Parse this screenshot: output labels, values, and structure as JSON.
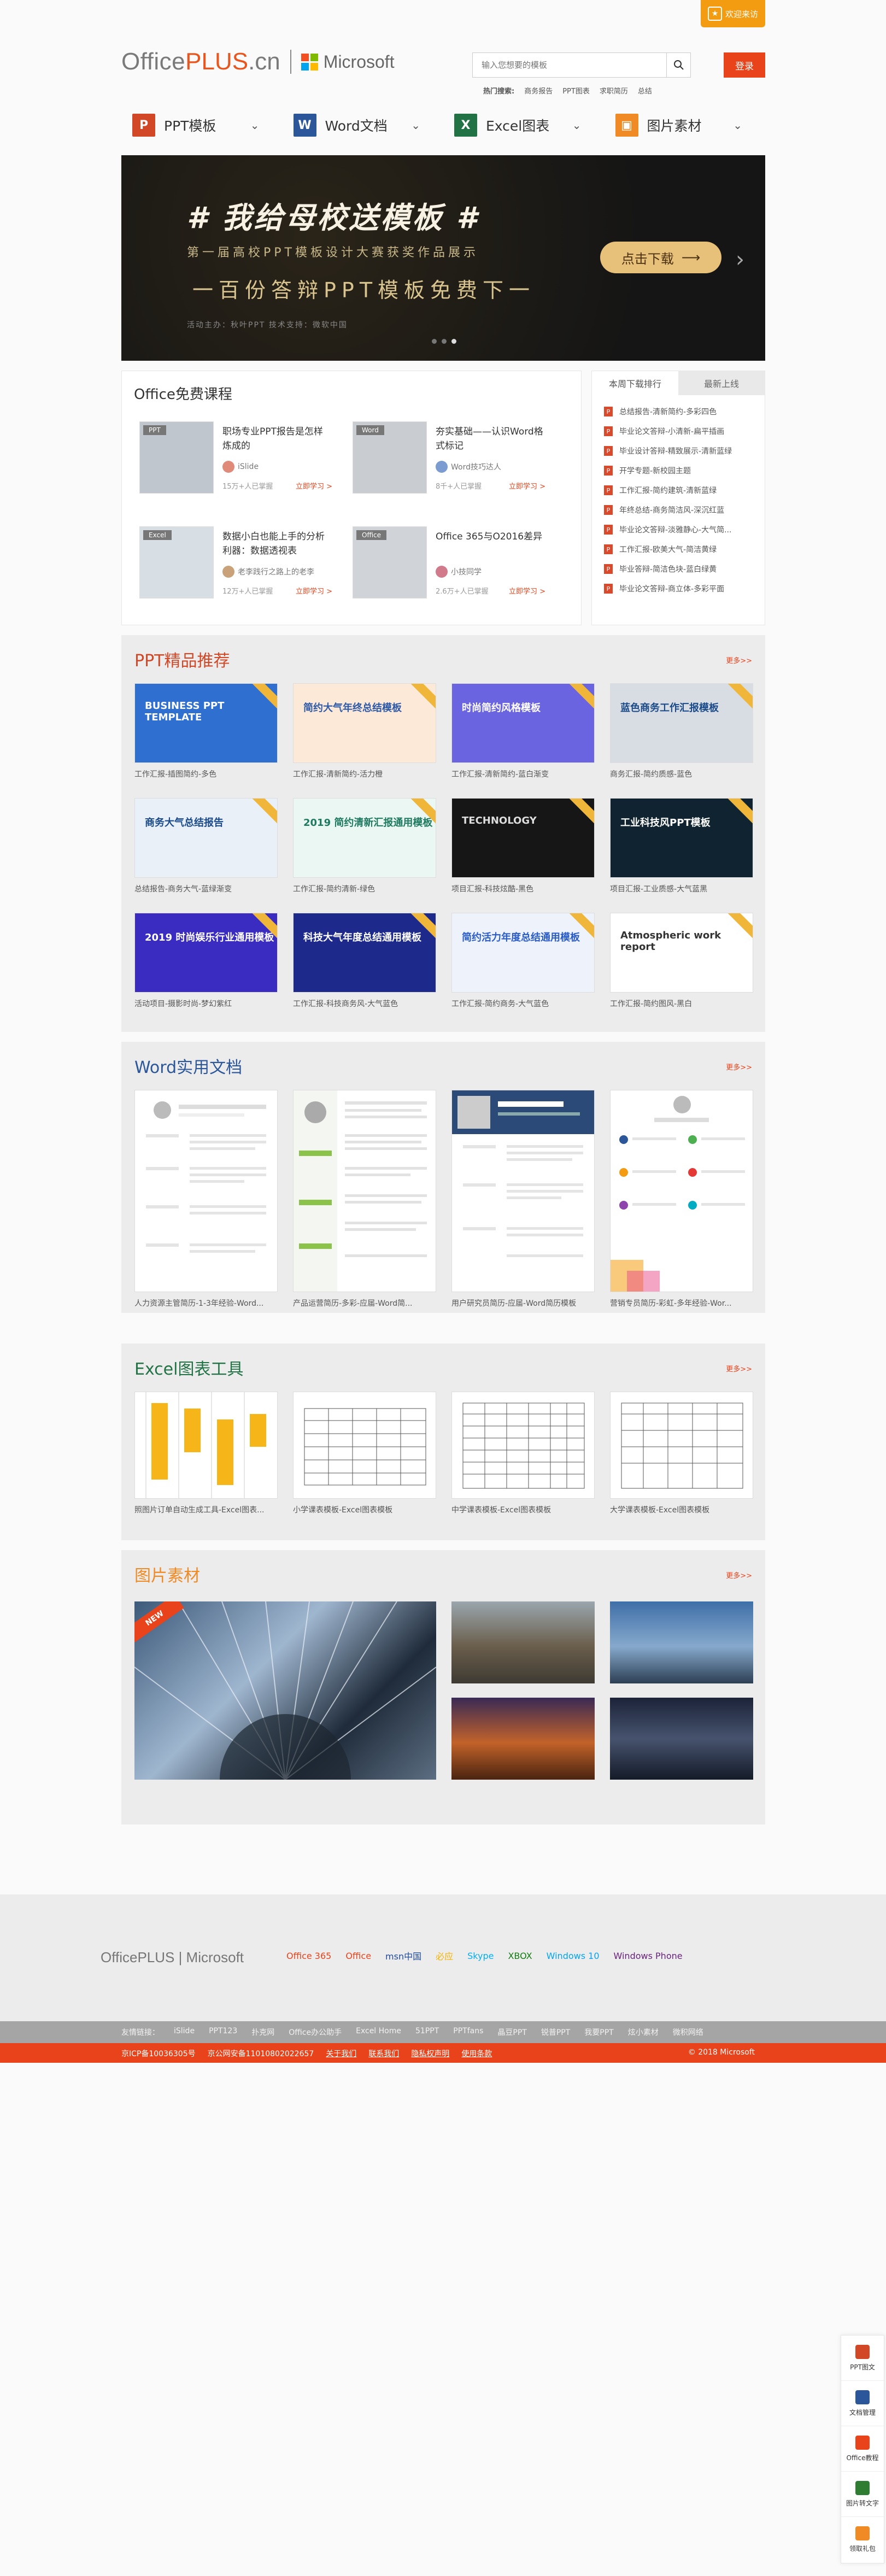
{
  "header": {
    "fav_label": "欢迎来访",
    "logo": {
      "office": "Office",
      "plus": "PLUS",
      "cn": ".cn",
      "ms": "Microsoft"
    },
    "search_placeholder": "输入您想要的模板",
    "login_label": "登录",
    "hot_label": "热门搜索:",
    "hot_items": [
      "商务报告",
      "PPT图表",
      "求职简历",
      "总结"
    ]
  },
  "nav": [
    {
      "label": "PPT模板",
      "icon": "P",
      "color": "#d24726"
    },
    {
      "label": "Word文档",
      "icon": "W",
      "color": "#2b579a"
    },
    {
      "label": "Excel图表",
      "icon": "X",
      "color": "#217346"
    },
    {
      "label": "图片素材",
      "icon": "▣",
      "color": "#f08a24"
    }
  ],
  "banner": {
    "title": "# 我给母校送模板 #",
    "subtitle": "第一届高校PPT模板设计大赛获奖作品展示",
    "subtitle2": "一百份答辩PPT模板免费下一",
    "footer": "活动主办：秋叶PPT     技术支持：微软中国",
    "button": "点击下载"
  },
  "courses": {
    "title": "Office免费课程",
    "items": [
      {
        "tag": "PPT",
        "title": "职场专业PPT报告是怎样炼成的",
        "author": "iSlide",
        "learners": "15万+人已掌握",
        "go": "立即学习 >"
      },
      {
        "tag": "Word",
        "title": "夯实基础——认识Word格式标记",
        "author": "Word技巧达人",
        "learners": "8千+人已掌握",
        "go": "立即学习 >"
      },
      {
        "tag": "Excel",
        "title": "数据小白也能上手的分析利器：数据透视表",
        "author": "老李践行之路上的老李",
        "learners": "12万+人已掌握",
        "go": "立即学习 >"
      },
      {
        "tag": "Office",
        "title": "Office 365与O2016差异",
        "author": "小技同学",
        "learners": "2.6万+人已掌握",
        "go": "立即学习 >"
      }
    ]
  },
  "ranking": {
    "tab1": "本周下载排行",
    "tab2": "最新上线",
    "items": [
      "总结报告-清新简约-多彩四色",
      "毕业论文答辩-小清新-扁平插画",
      "毕业设计答辩-精致展示-清新蓝绿",
      "开学专题-新校园主题",
      "工作汇报-简约建筑-清新蓝绿",
      "年终总结-商务简洁风-深沉红蓝",
      "毕业论文答辩-淡雅静心-大气简...",
      "工作汇报-欧美大气-简洁黄绿",
      "毕业答辩-简洁色块-蓝白绿黄",
      "毕业论文答辩-商立体-多彩平面"
    ]
  },
  "ppt": {
    "title": "PPT精品推荐",
    "more": "更多>>",
    "items": [
      {
        "cap": "工作汇报-插图简约-多色",
        "bg": "#2f6fd0",
        "text": "BUSINESS PPT TEMPLATE",
        "fg": "#ffffff"
      },
      {
        "cap": "工作汇报-清新简约-活力橙",
        "bg": "#fde9d8",
        "text": "简约大气年终总结模板",
        "fg": "#2d5aa8"
      },
      {
        "cap": "工作汇报-清新简约-蓝白渐变",
        "bg": "#6b64e0",
        "text": "时尚简约风格模板",
        "fg": "#ffffff"
      },
      {
        "cap": "商务汇报-简约质感-蓝色",
        "bg": "#d7dde2",
        "text": "蓝色商务工作汇报模板",
        "fg": "#1b4a8a"
      },
      {
        "cap": "总结报告-商务大气-蓝绿渐变",
        "bg": "#e9f0f7",
        "text": "商务大气总结报告",
        "fg": "#1b4a8a"
      },
      {
        "cap": "工作汇报-简约清新-绿色",
        "bg": "#eaf7f2",
        "text": "2019 简约清新汇报通用模板",
        "fg": "#1f7a60"
      },
      {
        "cap": "项目汇报-科技炫酷-黑色",
        "bg": "#161616",
        "text": "TECHNOLOGY",
        "fg": "#dddddd"
      },
      {
        "cap": "项目汇报-工业质感-大气蓝黑",
        "bg": "#0f2430",
        "text": "工业科技风PPT模板",
        "fg": "#ffffff"
      },
      {
        "cap": "活动项目-摄影时尚-梦幻紫红",
        "bg": "#3a2cc0",
        "text": "2019 时尚娱乐行业通用模板",
        "fg": "#ffffff"
      },
      {
        "cap": "工作汇报-科技商务风-大气蓝色",
        "bg": "#1d2a8c",
        "text": "科技大气年度总结通用模板",
        "fg": "#ffffff"
      },
      {
        "cap": "工作汇报-简约商务-大气蓝色",
        "bg": "#eef3fb",
        "text": "简约活力年度总结通用模板",
        "fg": "#2a5cc8"
      },
      {
        "cap": "工作汇报-简约图风-黑白",
        "bg": "#ffffff",
        "text": "Atmospheric work report",
        "fg": "#333333"
      }
    ]
  },
  "word": {
    "title": "Word实用文档",
    "more": "更多>>",
    "items": [
      {
        "cap": "人力资源主管简历-1-3年经验-Word..."
      },
      {
        "cap": "产品运营简历-多彩-应届-Word简..."
      },
      {
        "cap": "用户研究员简历-应届-Word简历模板"
      },
      {
        "cap": "营销专员简历-彩虹-多年经验-Wor..."
      }
    ]
  },
  "excel": {
    "title": "Excel图表工具",
    "more": "更多>>",
    "items": [
      {
        "cap": "照图片订单自动生成工具-Excel图表..."
      },
      {
        "cap": "小学课表模板-Excel图表模板"
      },
      {
        "cap": "中学课表模板-Excel图表模板"
      },
      {
        "cap": "大学课表模板-Excel图表模板"
      }
    ]
  },
  "images": {
    "title": "图片素材",
    "more": "更多>>",
    "new_badge": "NEW"
  },
  "footer": {
    "logo": "OfficePLUS | Microsoft",
    "partners": [
      "Office 365",
      "Office",
      "msn中国",
      "必应",
      "Skype",
      "XBOX",
      "Windows 10",
      "Windows Phone"
    ],
    "links": [
      "友情链接：",
      "iSlide",
      "PPT123",
      "扑克网",
      "Office办公助手",
      "Excel Home",
      "51PPT",
      "PPTfans",
      "晶豆PPT",
      "锐普PPT",
      "我要PPT",
      "炫小素材",
      "微积网络"
    ],
    "copy": [
      "京ICP备10036305号",
      "京公网安备11010802022657",
      "关于我们",
      "联系我们",
      "隐私权声明",
      "使用条款"
    ],
    "rights": "© 2018 Microsoft"
  },
  "float_bar": [
    "PPT图文",
    "文档管理",
    "Office教程",
    "图片转文字",
    "领取礼包"
  ]
}
